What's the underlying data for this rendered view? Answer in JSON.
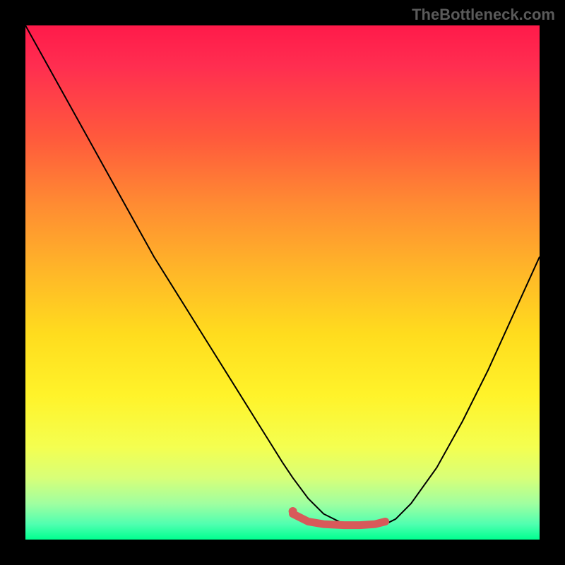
{
  "watermark": "TheBottleneck.com",
  "chart_data": {
    "type": "line",
    "title": "",
    "xlabel": "",
    "ylabel": "",
    "xlim": [
      0,
      100
    ],
    "ylim": [
      0,
      100
    ],
    "series": [
      {
        "name": "curve",
        "color": "#000000",
        "x": [
          0,
          5,
          10,
          15,
          20,
          25,
          30,
          35,
          40,
          45,
          50,
          52,
          55,
          58,
          62,
          65,
          68,
          70,
          72,
          75,
          80,
          85,
          90,
          95,
          100
        ],
        "y": [
          100,
          91,
          82,
          73,
          64,
          55,
          47,
          39,
          31,
          23,
          15,
          12,
          8,
          5,
          3,
          2.5,
          2.5,
          3,
          4,
          7,
          14,
          23,
          33,
          44,
          55
        ]
      },
      {
        "name": "highlight",
        "color": "#d85a5a",
        "x": [
          52,
          55,
          58,
          62,
          65,
          68,
          70
        ],
        "y": [
          5,
          3.5,
          3,
          2.8,
          2.8,
          3,
          3.5
        ]
      }
    ],
    "points": [
      {
        "name": "marker",
        "x": 52,
        "y": 5.5,
        "color": "#d85a5a"
      }
    ]
  }
}
